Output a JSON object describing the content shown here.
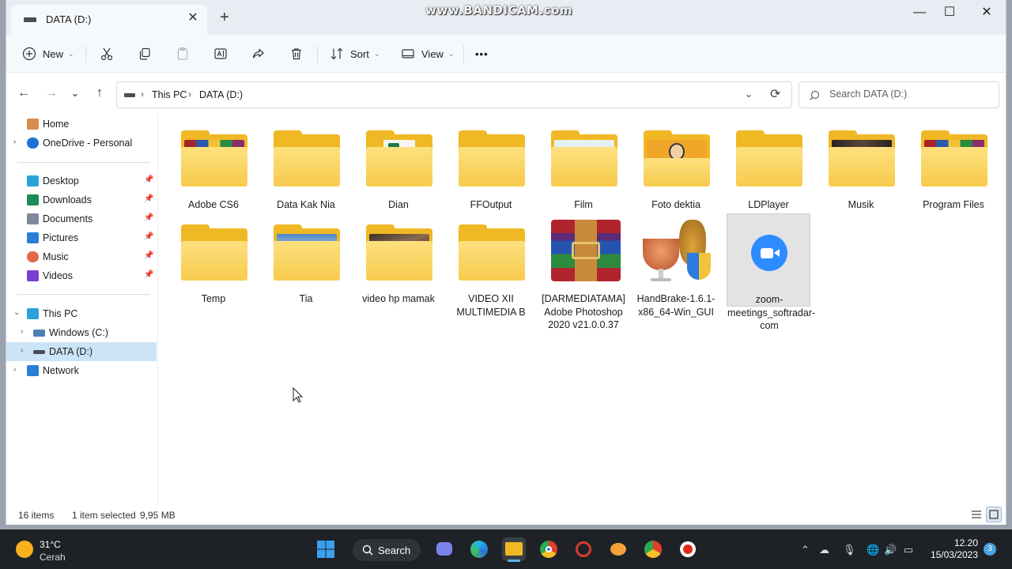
{
  "titlebar": {
    "tab_title": "DATA (D:)",
    "tab_close": "✕",
    "new_tab": "+",
    "watermark": "www.BANDICAM.com",
    "minimize": "—",
    "maximize": "☐",
    "close": "✕"
  },
  "toolbar": {
    "new_label": "New",
    "sort_label": "Sort",
    "view_label": "View",
    "more_label": "•••",
    "dropdown_glyph": "⌄"
  },
  "navigation": {
    "back": "←",
    "forward": "→",
    "recent": "⌄",
    "up": "↑",
    "breadcrumb": [
      "This PC",
      "DATA (D:)"
    ],
    "breadcrumb_sep": "›",
    "address_dropdown": "⌄",
    "refresh": "⟳",
    "search_placeholder": "Search DATA (D:)"
  },
  "sidebar": {
    "expand_glyph": "›",
    "expanded_glyph": "⌄",
    "pin_glyph": "📌",
    "quick": [
      {
        "label": "Home",
        "icon": "home-icon",
        "color": "#d98c4a"
      },
      {
        "label": "OneDrive - Personal",
        "icon": "cloud-icon",
        "color": "#1e73d2"
      }
    ],
    "pinned": [
      {
        "label": "Desktop",
        "icon": "desktop-icon",
        "color": "#2aa3d9"
      },
      {
        "label": "Downloads",
        "icon": "download-icon",
        "color": "#1e8a5a"
      },
      {
        "label": "Documents",
        "icon": "document-icon",
        "color": "#7d8a99"
      },
      {
        "label": "Pictures",
        "icon": "pictures-icon",
        "color": "#2a7fd4"
      },
      {
        "label": "Music",
        "icon": "music-icon",
        "color": "#e06a4a"
      },
      {
        "label": "Videos",
        "icon": "videos-icon",
        "color": "#7a3fd0"
      }
    ],
    "tree": [
      {
        "label": "This PC",
        "icon": "pc-icon",
        "color": "#2aa3d9"
      },
      {
        "label": "Windows (C:)",
        "icon": "drive-icon",
        "color": "#4b7fb5"
      },
      {
        "label": "DATA (D:)",
        "icon": "drive-icon",
        "color": "#4b4f55"
      },
      {
        "label": "Network",
        "icon": "network-icon",
        "color": "#2a7fd4"
      }
    ]
  },
  "items": [
    {
      "name": "Adobe CS6",
      "type": "folder",
      "preview": "winrar"
    },
    {
      "name": "Data Kak Nia",
      "type": "folder",
      "preview": "none"
    },
    {
      "name": "Dian",
      "type": "folder",
      "preview": "excel"
    },
    {
      "name": "FFOutput",
      "type": "folder",
      "preview": "none"
    },
    {
      "name": "Film",
      "type": "folder",
      "preview": "web"
    },
    {
      "name": "Foto dektia",
      "type": "folder",
      "preview": "cartoon"
    },
    {
      "name": "LDPlayer",
      "type": "folder",
      "preview": "none"
    },
    {
      "name": "Musik",
      "type": "folder",
      "preview": "photo"
    },
    {
      "name": "Program Files",
      "type": "folder",
      "preview": "winrar"
    },
    {
      "name": "Temp",
      "type": "folder",
      "preview": "none"
    },
    {
      "name": "Tia",
      "type": "folder",
      "preview": "sky"
    },
    {
      "name": "video hp mamak",
      "type": "folder",
      "preview": "rock"
    },
    {
      "name": "VIDEO XII MULTIMEDIA B",
      "type": "folder",
      "preview": "none"
    },
    {
      "name": "[DARMEDIATAMA] Adobe Photoshop 2020 v21.0.0.37",
      "type": "archive",
      "preview": "winrar-big"
    },
    {
      "name": "HandBrake-1.6.1-x86_64-Win_GUI",
      "type": "installer",
      "preview": "handbrake"
    },
    {
      "name": "zoom-meetings_softradar-com",
      "type": "installer",
      "preview": "zoom",
      "selected": true
    }
  ],
  "status": {
    "count": "16 items",
    "selection": "1 item selected",
    "size": "9,95 MB"
  },
  "taskbar": {
    "temperature": "31°C",
    "weather": "Cerah",
    "search_label": "Search",
    "time": "12.20",
    "date": "15/03/2023",
    "notifications": "3"
  },
  "colors": {
    "accent": "#0067c0",
    "folder": "#f0b824",
    "selection": "#cce4f7",
    "zoom": "#2d8cff"
  }
}
